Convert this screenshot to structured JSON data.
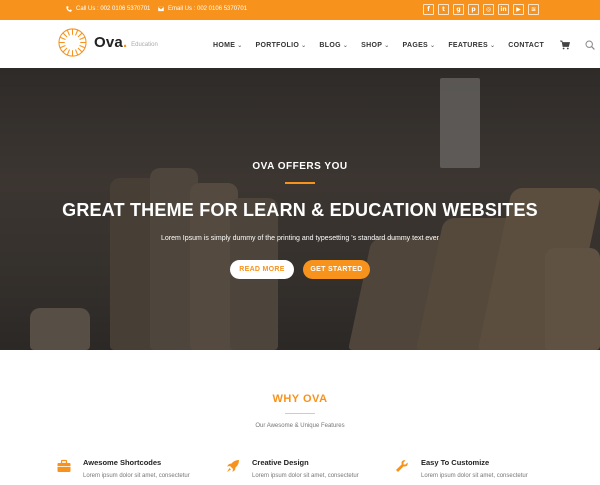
{
  "topbar": {
    "phone": "Call Us : 002 0106 5370701",
    "email": "Email Us : 002 0106 5370701",
    "socials": [
      "facebook-icon",
      "twitter-icon",
      "google-plus-icon",
      "pinterest-icon",
      "instagram-icon",
      "linkedin-icon",
      "youtube-icon",
      "rss-icon"
    ]
  },
  "header": {
    "logo_name": "Ova",
    "logo_dot": ".",
    "logo_tag": "Education",
    "nav": [
      {
        "label": "HOME",
        "dropdown": true
      },
      {
        "label": "PORTFOLIO",
        "dropdown": true
      },
      {
        "label": "BLOG",
        "dropdown": true
      },
      {
        "label": "SHOP",
        "dropdown": true
      },
      {
        "label": "PAGES",
        "dropdown": true
      },
      {
        "label": "FEATURES",
        "dropdown": true
      },
      {
        "label": "CONTACT",
        "dropdown": false
      }
    ],
    "chevron": "⌄"
  },
  "hero": {
    "kicker": "OVA OFFERS YOU",
    "headline": "GREAT THEME FOR LEARN & EDUCATION WEBSITES",
    "sub": "Lorem Ipsum is simply dummy of the printing and typesetting 's standard dummy text ever",
    "read_more": "READ MORE",
    "get_started": "GET STARTED"
  },
  "why": {
    "title": "WHY OVA",
    "subtitle": "Our Awesome & Unique Features",
    "features": [
      {
        "icon": "briefcase-icon",
        "title": "Awesome Shortcodes",
        "desc": "Lorem ipsum dolor sit amet, consectetur"
      },
      {
        "icon": "rocket-icon",
        "title": "Creative Design",
        "desc": "Lorem ipsum dolor sit amet, consectetur"
      },
      {
        "icon": "wrench-icon",
        "title": "Easy To Customize",
        "desc": "Lorem ipsum dolor sit amet, consectetur"
      }
    ]
  },
  "colors": {
    "accent": "#f7931d",
    "text_dark": "#222222",
    "hero_overlay": "#2a2622"
  }
}
